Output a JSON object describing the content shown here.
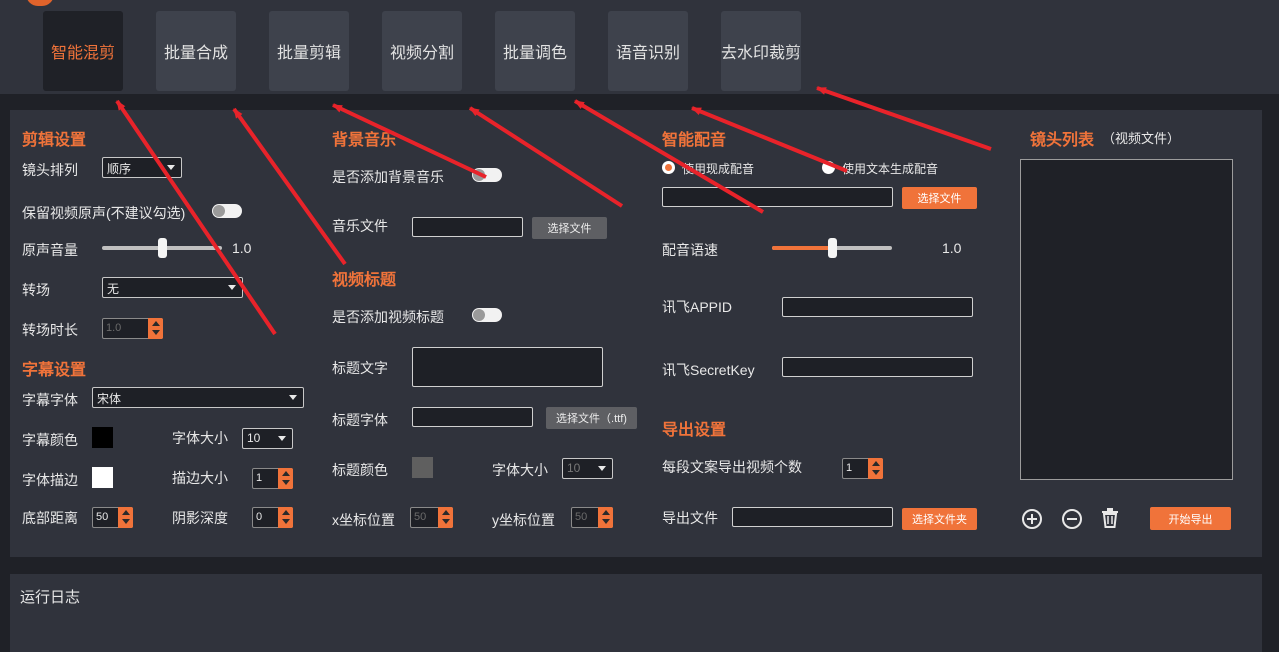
{
  "tabs": [
    {
      "label": "智能混剪",
      "active": true
    },
    {
      "label": "批量合成"
    },
    {
      "label": "批量剪辑"
    },
    {
      "label": "视频分割"
    },
    {
      "label": "批量调色"
    },
    {
      "label": "语音识别"
    },
    {
      "label": "去水印裁剪"
    }
  ],
  "edit": {
    "title": "剪辑设置",
    "shot_order_label": "镜头排列",
    "shot_order_value": "顺序",
    "keep_audio_label": "保留视频原声(不建议勾选)",
    "orig_volume_label": "原声音量",
    "orig_volume_value": "1.0",
    "orig_volume_level": 0.5,
    "transition_label": "转场",
    "transition_value": "无",
    "transition_duration_label": "转场时长",
    "transition_duration_value": "1.0"
  },
  "subtitle": {
    "title": "字幕设置",
    "font_label": "字幕字体",
    "font_value": "宋体",
    "color_label": "字幕颜色",
    "color": "#000000",
    "size_label": "字体大小",
    "size_value": "10",
    "stroke_label": "字体描边",
    "stroke_color": "#ffffff",
    "stroke_size_label": "描边大小",
    "stroke_size_value": "1",
    "bottom_label": "底部距离",
    "bottom_value": "50",
    "shadow_label": "阴影深度",
    "shadow_value": "0"
  },
  "bgm": {
    "title": "背景音乐",
    "add_label": "是否添加背景音乐",
    "file_label": "音乐文件",
    "file_button": "选择文件"
  },
  "video_title": {
    "title": "视频标题",
    "add_label": "是否添加视频标题",
    "text_label": "标题文字",
    "font_label": "标题字体",
    "font_button": "选择文件（.ttf)",
    "color_label": "标题颜色",
    "color": "#5f5f5f",
    "size_label": "字体大小",
    "size_value": "10",
    "x_label": "x坐标位置",
    "x_value": "50",
    "y_label": "y坐标位置",
    "y_value": "50"
  },
  "dubbing": {
    "title": "智能配音",
    "option1": "使用现成配音",
    "option2": "使用文本生成配音",
    "file_button": "选择文件",
    "speed_label": "配音语速",
    "speed_value": "1.0",
    "speed_level": 0.5,
    "appid_label": "讯飞APPID",
    "secret_label": "讯飞SecretKey"
  },
  "export": {
    "title": "导出设置",
    "count_label": "每段文案导出视频个数",
    "count_value": "1",
    "file_label": "导出文件",
    "folder_button": "选择文件夹"
  },
  "shots": {
    "title": "镜头列表",
    "subtitle": "（视频文件）",
    "start_button": "开始导出"
  },
  "log": {
    "title": "运行日志"
  },
  "colors": {
    "accent": "#f0733a",
    "panel": "#30333c",
    "background": "#1f2127",
    "annotation": "#e8232a"
  },
  "icons": [
    "plus-circle-icon",
    "minus-circle-icon",
    "trash-icon",
    "chevron-down-icon"
  ]
}
